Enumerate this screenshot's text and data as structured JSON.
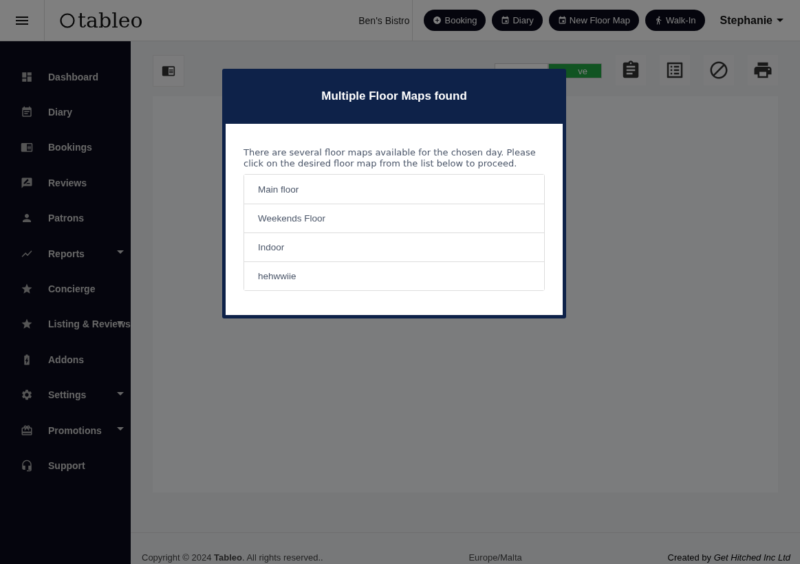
{
  "header": {
    "brand": "tableo",
    "venue": "Ben's Bistro",
    "actions": [
      {
        "kind": "booking",
        "label": "Booking"
      },
      {
        "kind": "diary",
        "label": "Diary"
      },
      {
        "kind": "floor",
        "label": "New Floor Map"
      },
      {
        "kind": "walkin",
        "label": "Walk-In"
      }
    ],
    "user": "Stephanie"
  },
  "sidebar": {
    "items": [
      {
        "kind": "dashboard",
        "label": "Dashboard",
        "expandable": false
      },
      {
        "kind": "diary",
        "label": "Diary",
        "expandable": false
      },
      {
        "kind": "bookings",
        "label": "Bookings",
        "expandable": false
      },
      {
        "kind": "reviews",
        "label": "Reviews",
        "expandable": false
      },
      {
        "kind": "patrons",
        "label": "Patrons",
        "expandable": false
      },
      {
        "kind": "reports",
        "label": "Reports",
        "expandable": true
      },
      {
        "kind": "star",
        "label": "Concierge",
        "expandable": false
      },
      {
        "kind": "star",
        "label": "Listing & Reviews",
        "expandable": true
      },
      {
        "kind": "addons",
        "label": "Addons",
        "expandable": false
      },
      {
        "kind": "settings",
        "label": "Settings",
        "expandable": true
      },
      {
        "kind": "promotions",
        "label": "Promotions",
        "expandable": true
      },
      {
        "kind": "support",
        "label": "Support",
        "expandable": false
      }
    ]
  },
  "toolbar": {
    "mode_toggle": [
      {
        "selected": false
      },
      {
        "label": "ve",
        "selected": true
      }
    ],
    "tools": [
      {
        "kind": "clipboard"
      },
      {
        "kind": "list"
      },
      {
        "kind": "block"
      },
      {
        "kind": "print"
      }
    ]
  },
  "modal": {
    "title": "Multiple Floor Maps found",
    "message": "There are several floor maps available for the chosen day. Please click on the desired floor map from the list below to proceed.",
    "floor_maps": [
      "Main floor",
      "Weekends Floor",
      "Indoor",
      "hehwwiie"
    ]
  },
  "footer": {
    "copyright": "Copyright © 2024 **Tableo**. All rights reserved..",
    "timezone": "Europe/Malta",
    "credit": "Created by *Get Hitched Inc Ltd*"
  }
}
